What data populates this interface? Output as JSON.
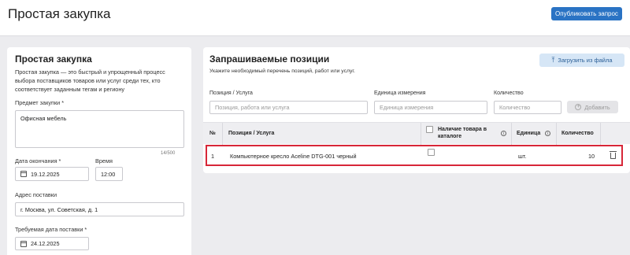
{
  "header": {
    "title": "Простая закупка",
    "publish_button": "Опубликовать запрос"
  },
  "left_panel": {
    "title": "Простая закупка",
    "description": "Простая закупка — это быстрый и упрощенный процесс выбора поставщиков товаров или услуг среди тех, кто соответствует заданным тегам и региону",
    "subject_label": "Предмет закупки *",
    "subject_value": "Офисная мебель",
    "char_counter": "14/500",
    "end_date_label": "Дата окончания *",
    "end_date_value": "19.12.2025",
    "time_label": "Время",
    "time_value": "12:00",
    "address_label": "Адрес поставки",
    "address_value": "г. Москва, ул. Советская, д. 1",
    "delivery_date_label": "Требуемая дата поставки *",
    "delivery_date_value": "24.12.2025"
  },
  "right_panel": {
    "title": "Запрашиваемые позиции",
    "subtitle": "Укажите необходимый перечень позиций, работ или услуг.",
    "upload_button": "Загрузить из файла",
    "form": {
      "position_label": "Позиция / Услуга",
      "position_placeholder": "Позиция, работа или услуга",
      "unit_label": "Единица измерения",
      "unit_placeholder": "Единица измерения",
      "qty_label": "Количество",
      "qty_placeholder": "Количество",
      "add_button": "Добавить"
    },
    "table": {
      "columns": [
        "№",
        "Позиция / Услуга",
        "Наличие товара в каталоге",
        "Единица",
        "Количество"
      ],
      "rows": [
        {
          "num": "1",
          "item": "Компьютерное кресло Aceline DTG-001 черный",
          "in_catalog": false,
          "unit": "шт.",
          "qty": "10"
        }
      ]
    }
  }
}
